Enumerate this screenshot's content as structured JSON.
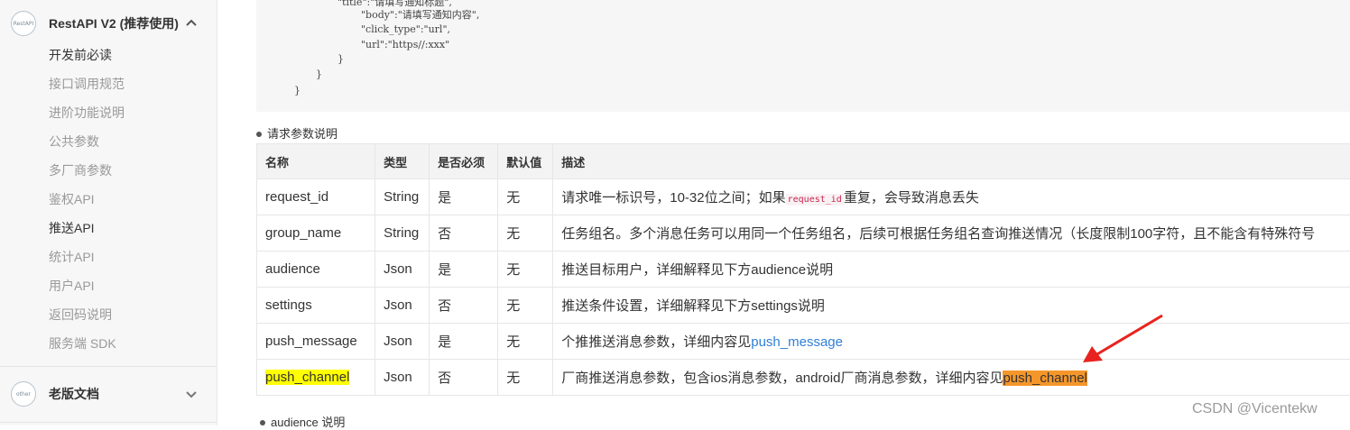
{
  "sidebar": {
    "section1": {
      "icon_text": "RestAPI",
      "title": "RestAPI V2 (推荐使用)",
      "icon": "chevron-up-icon"
    },
    "items": [
      {
        "label": "开发前必读"
      },
      {
        "label": "接口调用规范"
      },
      {
        "label": "进阶功能说明"
      },
      {
        "label": "公共参数"
      },
      {
        "label": "多厂商参数"
      },
      {
        "label": "鉴权API"
      },
      {
        "label": "推送API"
      },
      {
        "label": "统计API"
      },
      {
        "label": "用户API"
      },
      {
        "label": "返回码说明"
      },
      {
        "label": "服务端 SDK"
      }
    ],
    "section2": {
      "icon_text": "other",
      "title": "老版文档",
      "icon": "chevron-down-icon"
    }
  },
  "code": {
    "lines": [
      "\"body\":\"请填写通知内容\",",
      "\"click_type\":\"url\",",
      "\"url\":\"https//:xxx\"",
      "}",
      "}",
      "}"
    ]
  },
  "section_title": "请求参数说明",
  "table": {
    "headers": [
      "名称",
      "类型",
      "是否必须",
      "默认值",
      "描述"
    ],
    "rows": [
      {
        "name": "request_id",
        "type": "String",
        "required": "是",
        "default": "无",
        "desc_pre": "请求唯一标识号，10-32位之间；如果",
        "desc_code": "request_id",
        "desc_post": "重复，会导致消息丢失"
      },
      {
        "name": "group_name",
        "type": "String",
        "required": "否",
        "default": "无",
        "desc": "任务组名。多个消息任务可以用同一个任务组名，后续可根据任务组名查询推送情况（长度限制100字符，且不能含有特殊符号"
      },
      {
        "name": "audience",
        "type": "Json",
        "required": "是",
        "default": "无",
        "desc": "推送目标用户，详细解释见下方audience说明"
      },
      {
        "name": "settings",
        "type": "Json",
        "required": "否",
        "default": "无",
        "desc": "推送条件设置，详细解释见下方settings说明"
      },
      {
        "name": "push_message",
        "type": "Json",
        "required": "是",
        "default": "无",
        "desc_pre": "个推推送消息参数，详细内容见",
        "desc_link": "push_message"
      },
      {
        "name": "push_channel",
        "type": "Json",
        "required": "否",
        "default": "无",
        "desc_pre": "厂商推送消息参数，包含ios消息参数，android厂商消息参数，详细内容见",
        "desc_link": "push_channel"
      }
    ]
  },
  "next_section_title": "audience 说明",
  "watermark": "CSDN @Vicentekw",
  "colors": {
    "highlight_yellow": "#ffff00",
    "highlight_orange": "#f5962a",
    "link": "#2f7fd6",
    "arrow": "#e8231f"
  }
}
